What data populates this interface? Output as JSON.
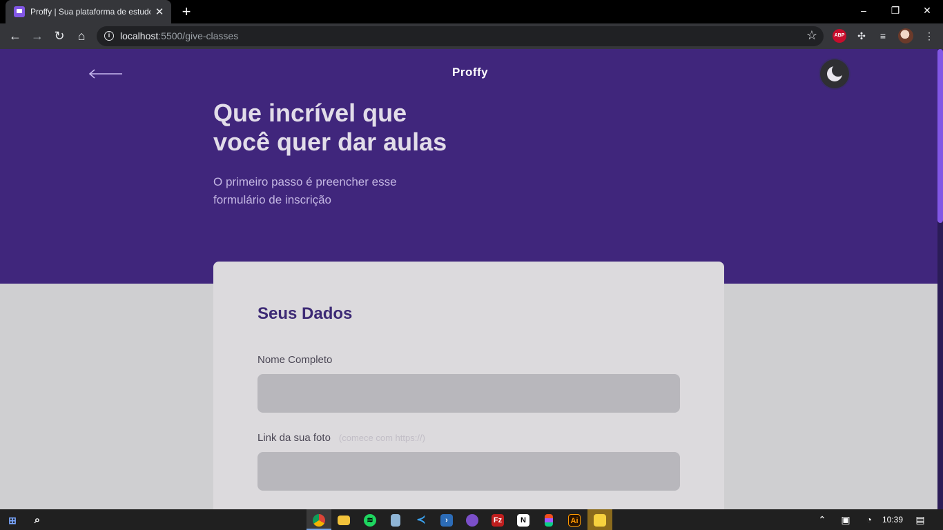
{
  "browser": {
    "tab_title": "Proffy | Sua plataforma de estudos",
    "new_tab": "+",
    "url_host": "localhost",
    "url_path": ":5500/give-classes",
    "window_controls": [
      "–",
      "❐",
      "✕"
    ],
    "extensions": {
      "abp": "ABP"
    }
  },
  "header": {
    "brand": "Proffy"
  },
  "hero": {
    "headline_line1": "Que incrível que",
    "headline_line2": "você quer dar aulas",
    "sub_line1": "O primeiro passo é preencher esse",
    "sub_line2": "formulário de inscrição"
  },
  "form": {
    "section_title": "Seus Dados",
    "fields": [
      {
        "label": "Nome Completo",
        "hint": "",
        "value": ""
      },
      {
        "label": "Link da sua foto",
        "hint": "(comece com https://)",
        "value": ""
      }
    ]
  },
  "taskbar": {
    "clock": "10:39",
    "apps": [
      "start",
      "search",
      "chrome",
      "file-explorer",
      "spotify",
      "notepad",
      "vscode",
      "powershell",
      "github-desktop",
      "filezilla",
      "notion",
      "figma",
      "illustrator",
      "sticky-notes"
    ]
  },
  "colors": {
    "hero_bg": "#40267c",
    "accent": "#8257e5",
    "card_bg": "#dcdadd",
    "section_title": "#3d2a75"
  }
}
